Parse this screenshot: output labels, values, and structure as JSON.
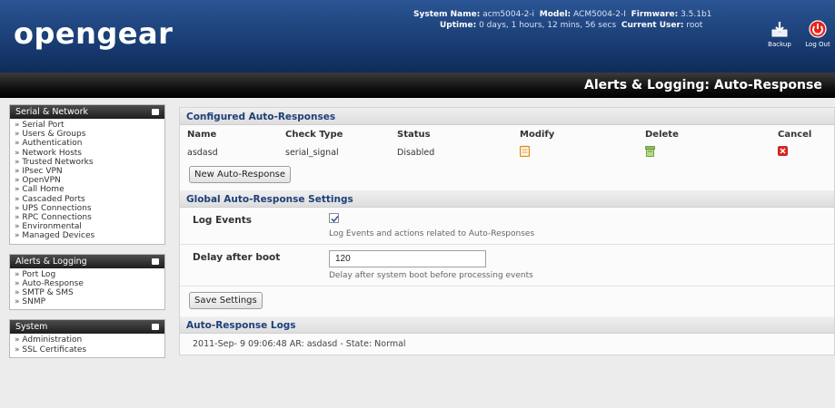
{
  "header": {
    "logo": "opengear",
    "system_name_label": "System Name:",
    "system_name": "acm5004-2-i",
    "model_label": "Model:",
    "model": "ACM5004-2-I",
    "firmware_label": "Firmware:",
    "firmware": "3.5.1b1",
    "uptime_label": "Uptime:",
    "uptime": "0 days, 1 hours, 12 mins, 56 secs",
    "current_user_label": "Current User:",
    "current_user": "root",
    "backup_label": "Backup",
    "logout_label": "Log Out"
  },
  "page_title": "Alerts & Logging: Auto-Response",
  "sidebar": {
    "sections": [
      {
        "title": "Serial & Network",
        "items": [
          "Serial Port",
          "Users & Groups",
          "Authentication",
          "Network Hosts",
          "Trusted Networks",
          "IPsec VPN",
          "OpenVPN",
          "Call Home",
          "Cascaded Ports",
          "UPS Connections",
          "RPC Connections",
          "Environmental",
          "Managed Devices"
        ]
      },
      {
        "title": "Alerts & Logging",
        "items": [
          "Port Log",
          "Auto-Response",
          "SMTP & SMS",
          "SNMP"
        ]
      },
      {
        "title": "System",
        "items": [
          "Administration",
          "SSL Certificates"
        ]
      }
    ]
  },
  "configured": {
    "title": "Configured Auto-Responses",
    "columns": [
      "Name",
      "Check Type",
      "Status",
      "Modify",
      "Delete",
      "Cancel"
    ],
    "rows": [
      {
        "name": "asdasd",
        "check_type": "serial_signal",
        "status": "Disabled"
      }
    ],
    "new_button": "New Auto-Response"
  },
  "global_settings": {
    "title": "Global Auto-Response Settings",
    "log_events_label": "Log Events",
    "log_events_checked": true,
    "log_events_desc": "Log Events and actions related to Auto-Responses",
    "delay_label": "Delay after boot",
    "delay_value": "120",
    "delay_desc": "Delay after system boot before processing events",
    "save_button": "Save Settings"
  },
  "logs": {
    "title": "Auto-Response Logs",
    "lines": [
      "2011-Sep- 9 09:06:48 AR: asdasd - State: Normal"
    ]
  },
  "icons": {
    "modify": "edit-icon",
    "delete": "delete-icon",
    "cancel": "cancel-icon",
    "backup": "backup-icon",
    "logout": "power-icon"
  },
  "colors": {
    "header_blue": "#16386d",
    "section_title": "#1e3f78",
    "logout_red": "#e8231b"
  }
}
